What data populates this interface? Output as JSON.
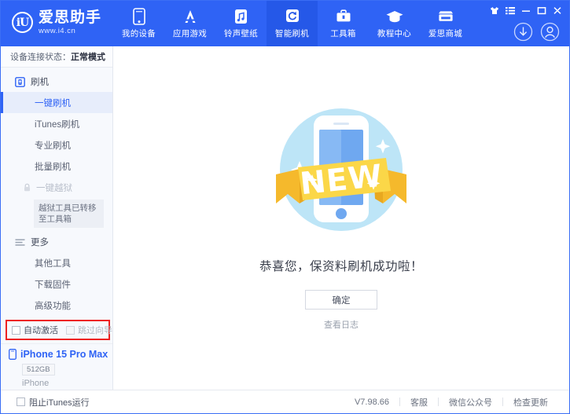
{
  "window": {
    "controls": [
      {
        "name": "skin-icon",
        "glyph": "skin"
      },
      {
        "name": "menu-icon",
        "glyph": "menu"
      },
      {
        "name": "minimize-button",
        "glyph": "minimize"
      },
      {
        "name": "maximize-button",
        "glyph": "maximize"
      },
      {
        "name": "close-button",
        "glyph": "close"
      }
    ],
    "account": [
      {
        "name": "download-icon",
        "glyph": "download"
      },
      {
        "name": "user-avatar-icon",
        "glyph": "user"
      }
    ]
  },
  "brand": {
    "mark": "iU",
    "title": "爱思助手",
    "url": "www.i4.cn"
  },
  "nav": {
    "items": [
      {
        "label": "我的设备",
        "icon": "phone-icon",
        "active": false
      },
      {
        "label": "应用游戏",
        "icon": "appstore-icon",
        "active": false
      },
      {
        "label": "铃声壁纸",
        "icon": "music-icon",
        "active": false
      },
      {
        "label": "智能刷机",
        "icon": "refresh-icon",
        "active": true
      },
      {
        "label": "工具箱",
        "icon": "toolbox-icon",
        "active": false
      },
      {
        "label": "教程中心",
        "icon": "graduation-cap-icon",
        "active": false
      },
      {
        "label": "爱思商城",
        "icon": "store-icon",
        "active": false
      }
    ]
  },
  "sidebar": {
    "connection_label": "设备连接状态：",
    "connection_value": "正常模式",
    "section_flash": {
      "title": "刷机",
      "icon": "flash-device-icon",
      "items": [
        {
          "label": "一键刷机",
          "active": true,
          "disabled": false
        },
        {
          "label": "iTunes刷机",
          "active": false,
          "disabled": false
        },
        {
          "label": "专业刷机",
          "active": false,
          "disabled": false
        },
        {
          "label": "批量刷机",
          "active": false,
          "disabled": false
        },
        {
          "label": "一键越狱",
          "active": false,
          "disabled": true
        }
      ]
    },
    "tooltip": "越狱工具已转移至工具箱",
    "section_more": {
      "title": "更多",
      "icon": "list-icon",
      "items": [
        {
          "label": "其他工具",
          "active": false,
          "disabled": false
        },
        {
          "label": "下载固件",
          "active": false,
          "disabled": false
        },
        {
          "label": "高级功能",
          "active": false,
          "disabled": false
        }
      ]
    },
    "options": [
      {
        "label": "自动激活",
        "checked": false,
        "disabled": false
      },
      {
        "label": "跳过向导",
        "checked": false,
        "disabled": true
      }
    ],
    "highlight_color": "#ee2222",
    "device": {
      "name": "iPhone 15 Pro Max",
      "capacity": "512GB",
      "type": "iPhone",
      "icon": "phone-icon"
    }
  },
  "main": {
    "illustration": {
      "name": "new-phone-badge-illustration",
      "ribbon_text": "NEW",
      "circle_color": "#bde5f7",
      "ribbon_color": "#fbd748",
      "ribbon_shadow_color": "#f5b92c",
      "screen_color": "#6fa8f0"
    },
    "message": "恭喜您，保资料刷机成功啦！",
    "confirm_label": "确定",
    "log_link": "查看日志"
  },
  "statusbar": {
    "block_itunes": {
      "label": "阻止iTunes运行",
      "checked": false
    },
    "version": "V7.98.66",
    "links": [
      "客服",
      "微信公众号",
      "检查更新"
    ]
  },
  "colors": {
    "brand_blue": "#2f63f5",
    "active_nav": "#2558e8",
    "sidebar_bg": "#f7f9fd"
  }
}
